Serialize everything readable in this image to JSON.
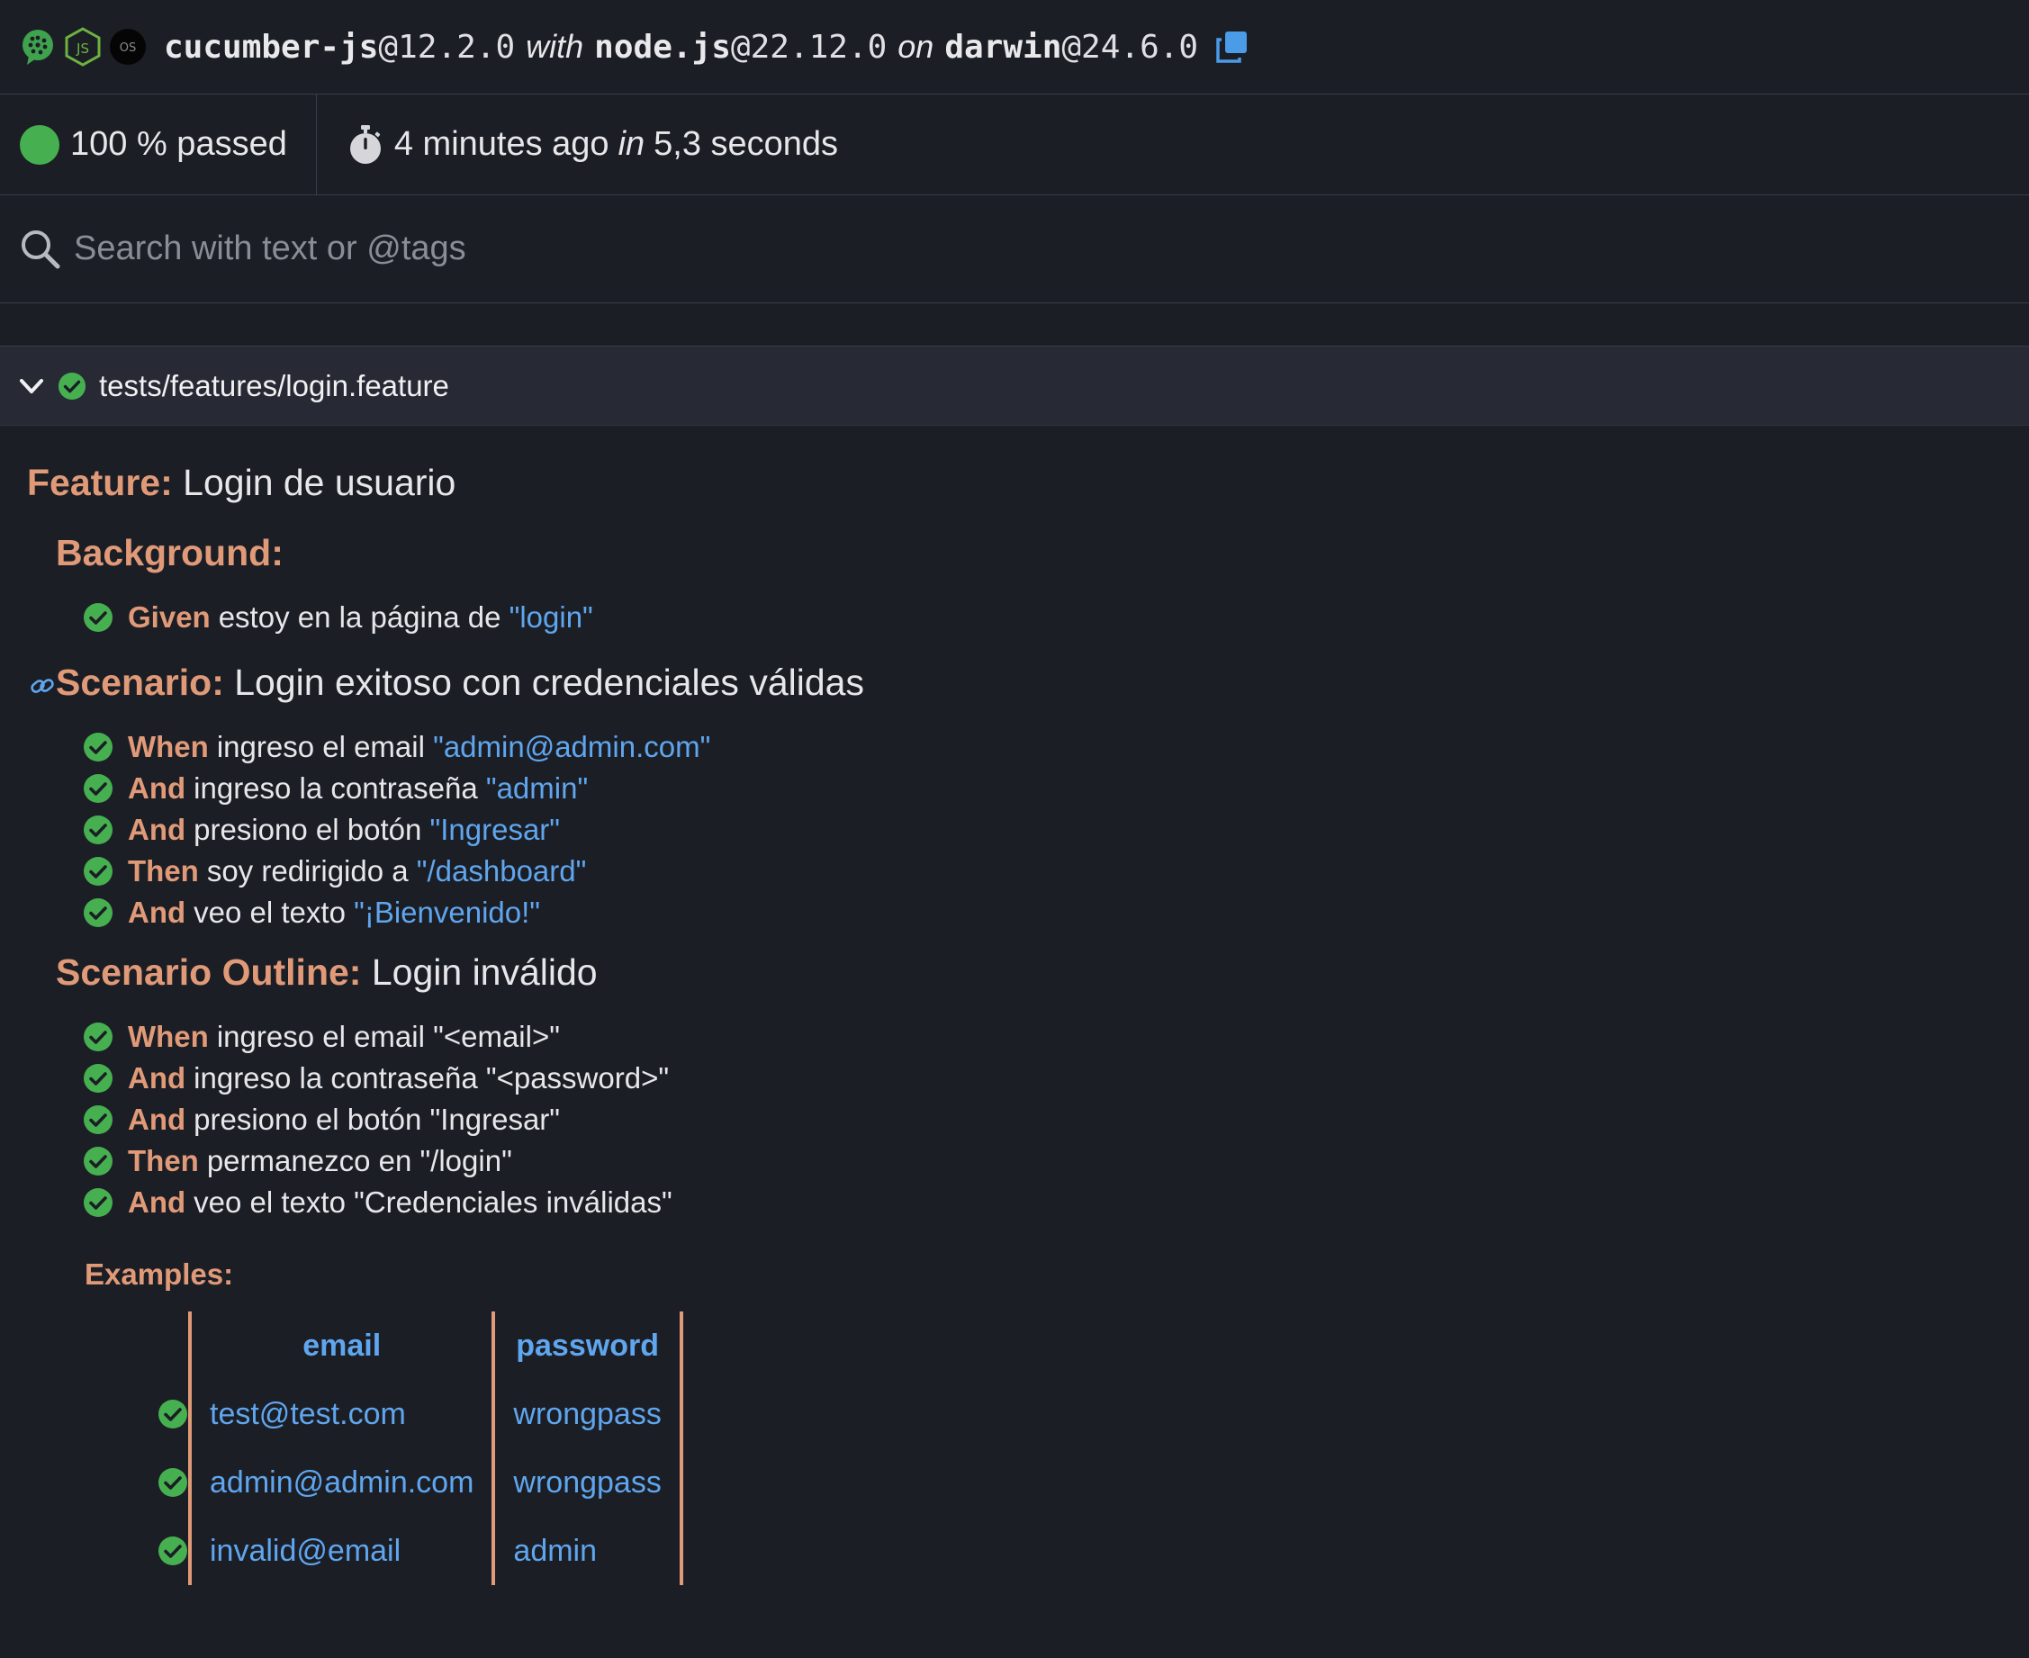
{
  "env": {
    "icons": [
      "cucumber-icon",
      "nodejs-icon",
      "os-icon"
    ],
    "os_icon_text": "OS",
    "runner_name": "cucumber-js",
    "runner_version": "@12.2.0",
    "with_word": "with",
    "runtime_name": "node.js",
    "runtime_version": "@22.12.0",
    "on_word": "on",
    "os_name": "darwin",
    "os_version": "@24.6.0",
    "copy_icon": "copy-icon"
  },
  "status": {
    "passed_text": "100 % passed",
    "time_ago": "4 minutes ago",
    "in_word": "in",
    "duration": "5,3 seconds"
  },
  "search": {
    "placeholder": "Search with text or @tags"
  },
  "feature_file": {
    "path": "tests/features/login.feature"
  },
  "document": {
    "feature": {
      "keyword": "Feature:",
      "name": "Login de usuario"
    },
    "background": {
      "keyword": "Background:",
      "steps": [
        {
          "keyword": "Given",
          "text": "estoy en la página de ",
          "param": "\"login\""
        }
      ]
    },
    "scenario": {
      "keyword": "Scenario:",
      "name": "Login exitoso con credenciales válidas",
      "steps": [
        {
          "keyword": "When",
          "text": "ingreso el email ",
          "param": "\"admin@admin.com\""
        },
        {
          "keyword": "And",
          "text": "ingreso la contraseña ",
          "param": "\"admin\""
        },
        {
          "keyword": "And",
          "text": "presiono el botón ",
          "param": "\"Ingresar\""
        },
        {
          "keyword": "Then",
          "text": "soy redirigido a ",
          "param": "\"/dashboard\""
        },
        {
          "keyword": "And",
          "text": "veo el texto ",
          "param": "\"¡Bienvenido!\""
        }
      ]
    },
    "outline": {
      "keyword": "Scenario Outline:",
      "name": "Login inválido",
      "steps": [
        {
          "keyword": "When",
          "text": "ingreso el email \"<email>\""
        },
        {
          "keyword": "And",
          "text": "ingreso la contraseña \"<password>\""
        },
        {
          "keyword": "And",
          "text": "presiono el botón \"Ingresar\""
        },
        {
          "keyword": "Then",
          "text": "permanezco en \"/login\""
        },
        {
          "keyword": "And",
          "text": "veo el texto \"Credenciales inválidas\""
        }
      ],
      "examples": {
        "keyword": "Examples:",
        "headers": [
          "email",
          "password"
        ],
        "rows": [
          [
            "test@test.com",
            "wrongpass"
          ],
          [
            "admin@admin.com",
            "wrongpass"
          ],
          [
            "invalid@email",
            "admin"
          ]
        ]
      }
    }
  },
  "colors": {
    "background": "#1c1e26",
    "keyword": "#e09a78",
    "param": "#5fa6ee",
    "passed": "#46b050"
  }
}
